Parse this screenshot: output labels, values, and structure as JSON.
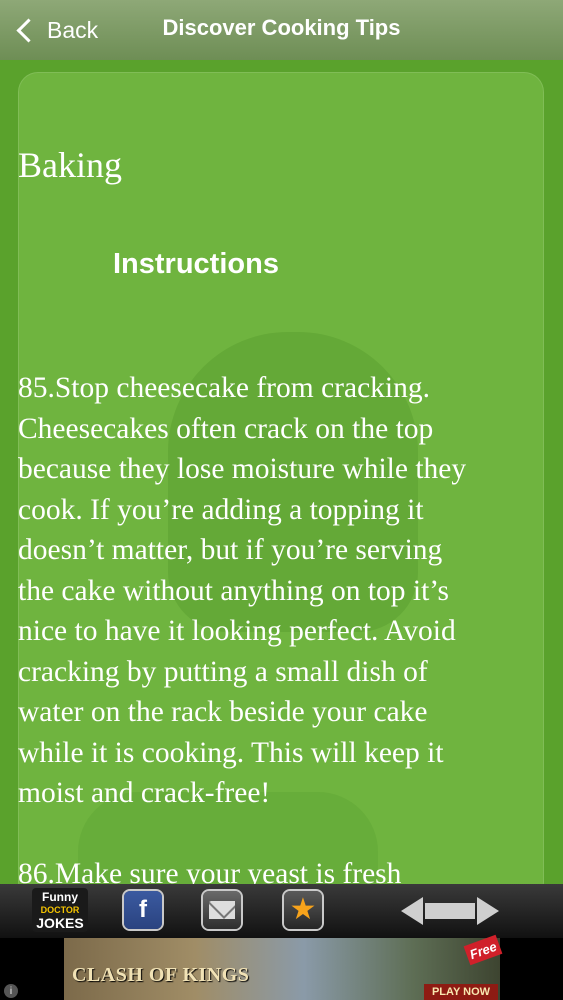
{
  "navbar": {
    "back_label": "Back",
    "title": "Discover Cooking Tips"
  },
  "content": {
    "section_title": "Baking",
    "instructions_heading": "Instructions",
    "body": "85.Stop cheesecake from cracking.\nCheesecakes often crack on the top\nbecause they lose moisture while they\ncook. If you’re adding a topping it\ndoesn’t matter, but if you’re serving\nthe cake without anything on top it’s\nnice to have it looking perfect. Avoid\ncracking by putting a small dish of\nwater on the rack beside your cake\nwhile it is cooking. This will keep it\nmoist and crack-free!",
    "next_partial": "86.Make sure your yeast is fresh"
  },
  "toolbar": {
    "logo_line1": "Funny",
    "logo_line2": "DOCTOR",
    "logo_line3": "JOKES",
    "facebook_glyph": "f",
    "star_glyph": "★",
    "icons": [
      "facebook-icon",
      "mail-icon",
      "star-icon",
      "prev-next-arrows-icon"
    ]
  },
  "ad": {
    "title": "CLASH OF KINGS",
    "badge": "Free",
    "cta": "PLAY NOW",
    "info": "i"
  }
}
